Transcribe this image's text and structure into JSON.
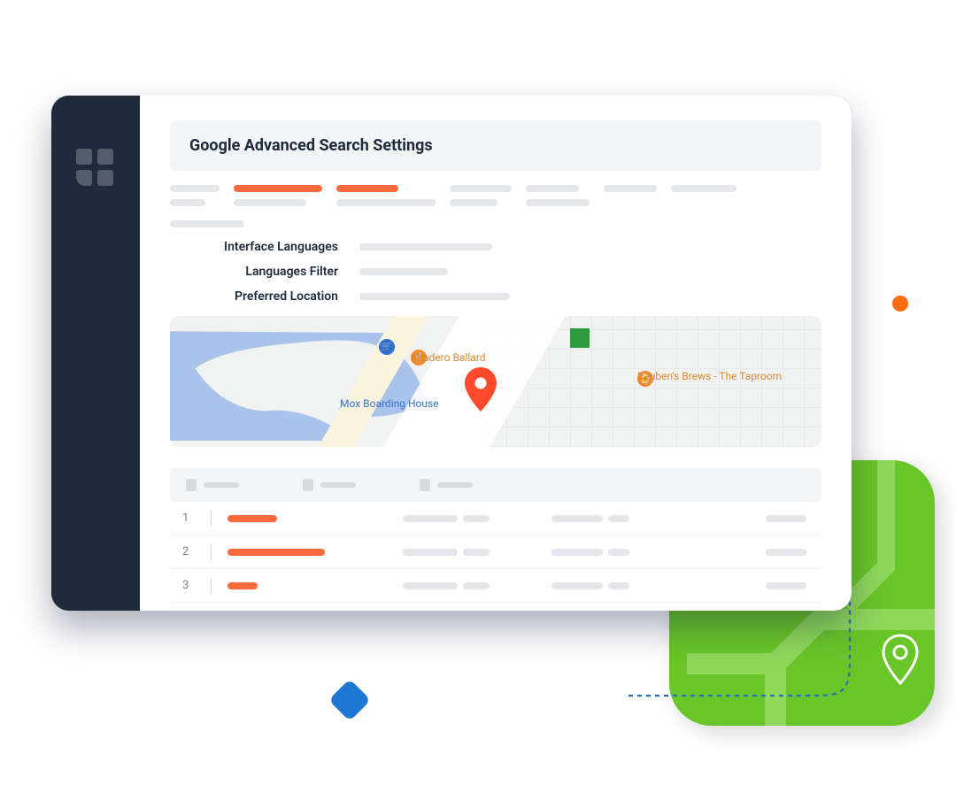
{
  "header": {
    "title": "Google Advanced Search Settings"
  },
  "settings": {
    "rows": [
      {
        "label": "Interface Languages"
      },
      {
        "label": "Languages Filter"
      },
      {
        "label": "Preferred Location"
      }
    ]
  },
  "map": {
    "places": {
      "asadero": "Asadero Ballard",
      "mox": "Mox Boarding House",
      "reubens": "Reuben's Brews - The Taproom"
    }
  },
  "table": {
    "rows": [
      {
        "idx": "1"
      },
      {
        "idx": "2"
      },
      {
        "idx": "3"
      }
    ]
  },
  "deco": {
    "orange_dot": "node",
    "blue_diamond": "waypoint",
    "green_card": "map-tile"
  }
}
